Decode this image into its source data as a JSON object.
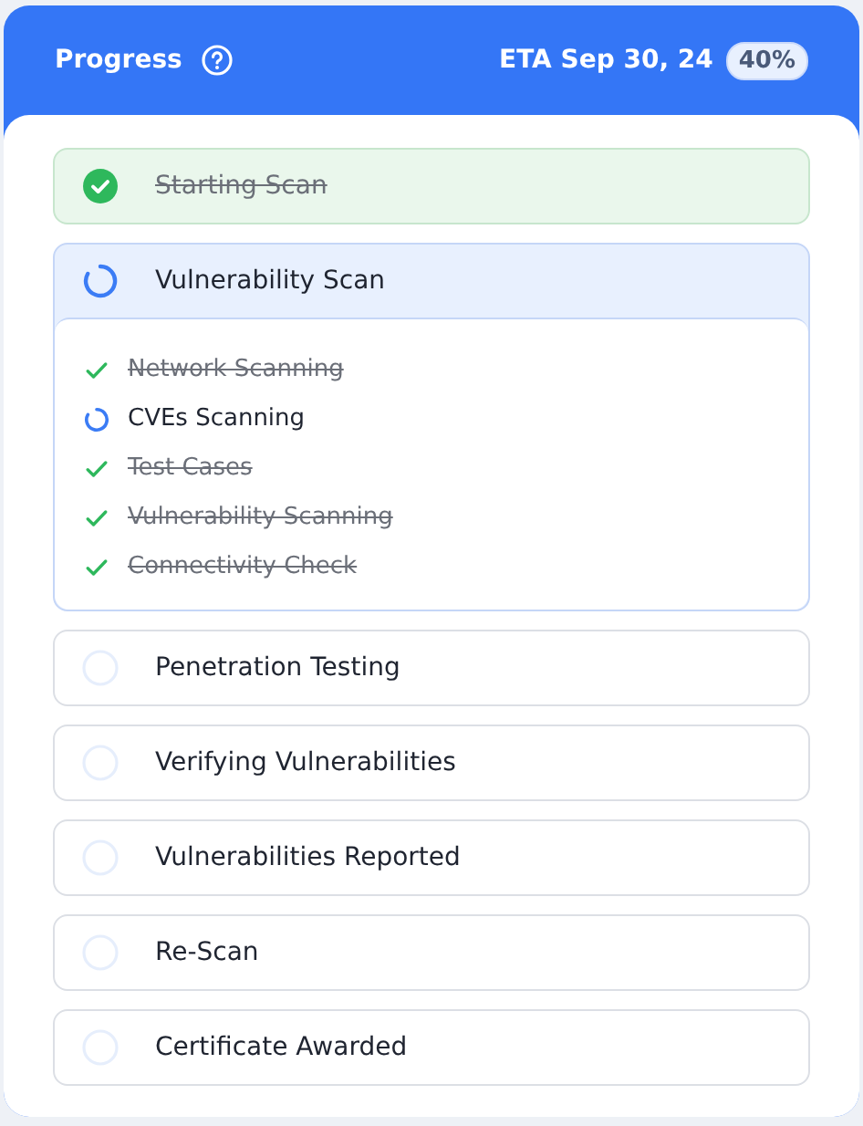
{
  "header": {
    "title": "Progress",
    "eta": "ETA Sep 30, 24",
    "percent": "40%"
  },
  "steps": [
    {
      "label": "Starting Scan",
      "kind": "done"
    },
    {
      "label": "Vulnerability Scan",
      "kind": "active",
      "expanded": true,
      "children": [
        {
          "label": "Network Scanning",
          "kind": "done"
        },
        {
          "label": "CVEs Scanning",
          "kind": "active"
        },
        {
          "label": "Test Cases",
          "kind": "done"
        },
        {
          "label": "Vulnerability Scanning",
          "kind": "done"
        },
        {
          "label": "Connectivity Check",
          "kind": "done"
        }
      ]
    },
    {
      "label": "Penetration Testing",
      "kind": "pending"
    },
    {
      "label": "Verifying Vulnerabilities",
      "kind": "pending"
    },
    {
      "label": "Vulnerabilities Reported",
      "kind": "pending"
    },
    {
      "label": "Re-Scan",
      "kind": "pending"
    },
    {
      "label": "Certificate Awarded",
      "kind": "pending"
    }
  ]
}
